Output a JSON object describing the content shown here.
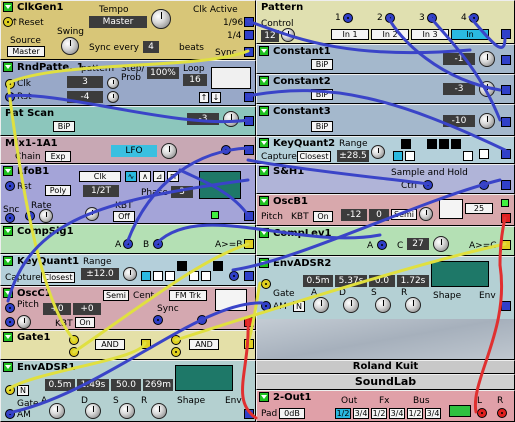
{
  "modules_left": {
    "clkgen": {
      "title": "ClkGen1",
      "reset": "↑Reset",
      "tempo_label": "Tempo",
      "tempo_value": "Master",
      "clk_active": "Clk Active",
      "div1": "1/96",
      "div2": "1/4",
      "swing": "Swing",
      "source": "Source",
      "source_value": "Master",
      "sync_every": "Sync every",
      "sync_value": "4",
      "beats": "beats",
      "sync": "Sync"
    },
    "rndpattern": {
      "title": "RndPatte..1",
      "pattern": "pattern",
      "clk": "Clk",
      "rst": "Rst",
      "step": "Step/",
      "prob": "Prob",
      "value1": "100%",
      "loop": "Loop",
      "loop_value": "16",
      "d1": "3",
      "d2": "-4"
    },
    "patscan": {
      "title": "Pat Scan",
      "bip": "BiP",
      "value": "-3"
    },
    "mix": {
      "title": "Mix1-1A1",
      "chain": "Chain",
      "exp": "Exp",
      "lfo": "LFO"
    },
    "lfob": {
      "title": "LfoB1",
      "rst": "Rst",
      "clk": "Clk",
      "rate_disp": "1/2T",
      "poly": "Poly",
      "phase": "Phase",
      "phase_value": "3",
      "snc": "Snc",
      "rate": "Rate",
      "kbt": "KBT",
      "off": "Off"
    },
    "compsig": {
      "title": "CompSig1",
      "a": "A",
      "b": "B",
      "out": "A>=B"
    },
    "keyquant": {
      "title": "KeyQuant1",
      "range": "Range",
      "range_value": "±12.0",
      "capture": "Capture",
      "closest": "Closest"
    },
    "osc": {
      "title": "OscC1",
      "semi": "Semi",
      "cent": "Cent",
      "fm_trk": "FM Trk",
      "pitch": "Pitch",
      "v1": "+0",
      "v2": "+0",
      "kbt": "KBT",
      "on": "On",
      "sync": "Sync"
    },
    "gate": {
      "title": "Gate1",
      "and1": "AND",
      "and2": "AND"
    },
    "envadsr1": {
      "title": "EnvADSR1",
      "gate": "Gate",
      "am": "AM",
      "a": "A",
      "d": "D",
      "s": "S",
      "r": "R",
      "shape": "Shape",
      "env": "Env",
      "n": "N",
      "t1": "0.5m",
      "t2": "1.49s",
      "t3": "50.0",
      "t4": "269m"
    }
  },
  "modules_right": {
    "pattern": {
      "title": "Pattern",
      "control": "Control",
      "control_value": "12",
      "n1": "1",
      "n2": "2",
      "n3": "3",
      "n4": "4",
      "in1": "In 1",
      "in2": "In 2",
      "in3": "In 3",
      "in4": "In"
    },
    "constant1": {
      "title": "Constant1",
      "bip": "BiP",
      "value": "-1"
    },
    "constant2": {
      "title": "Constant2",
      "bip": "BiP",
      "value": "-3"
    },
    "constant3": {
      "title": "Constant3",
      "bip": "BiP",
      "value": "-10"
    },
    "keyquant2": {
      "title": "KeyQuant2",
      "range": "Range",
      "capture": "Capture",
      "closest": "Closest",
      "range_value": "±28.5"
    },
    "sh": {
      "title": "S&H1",
      "sample_hold": "Sample and Hold",
      "ctrl": "Ctrl"
    },
    "oscb": {
      "title": "OscB1",
      "pitch": "Pitch",
      "kbt": "KBT",
      "on": "On",
      "v": "-12",
      "v2": "0",
      "semi": "Semi",
      "n25": "25"
    },
    "complev": {
      "title": "CompLev1",
      "a": "A",
      "c": "C",
      "c_value": "27",
      "out": "A>=C"
    },
    "envadsr2": {
      "title": "EnvADSR2",
      "gate": "Gate",
      "am": "AM",
      "n": "N",
      "a": "A",
      "d": "D",
      "s": "S",
      "r": "R",
      "shape": "Shape",
      "env": "Env",
      "t1": "0.5m",
      "t2": "5.37s",
      "t3": "0.0",
      "t4": "1.72s"
    },
    "brand1": "Roland Kuit",
    "brand2": "SoundLab",
    "out": {
      "title": "2-Out1",
      "pad": "Pad",
      "pad_value": "0dB",
      "out": "Out",
      "fx": "Fx",
      "bus": "Bus",
      "o1": "1/2",
      "o2": "3/4",
      "f1": "1/2",
      "f2": "3/4",
      "b1": "1/2",
      "b2": "3/4",
      "l": "L",
      "r": "R"
    }
  },
  "colors": {
    "clkgen": "#d8c678",
    "rndpattern": "#98a8c8",
    "patscan": "#8cc6bc",
    "mix": "#c8a8b4",
    "lfob": "#a4a4d8",
    "compsig": "#b4e0b4",
    "keyquant": "#b4cfda",
    "osc": "#d4a8b0",
    "gate": "#e4e0a8",
    "envadsr": "#b4d0d0",
    "pattern": "#e0e0b0",
    "constant": "#a4b8cc",
    "keyquant2": "#b4d0da",
    "sh": "#b0b4d8",
    "oscb": "#d8a8ac",
    "complev": "#b4e0b4",
    "envadsr2": "#b4d0d4",
    "out": "#e0a0a8",
    "cable_blue": "#3a44c8",
    "cable_yellow": "#e0e040",
    "cable_red": "#e03030"
  }
}
